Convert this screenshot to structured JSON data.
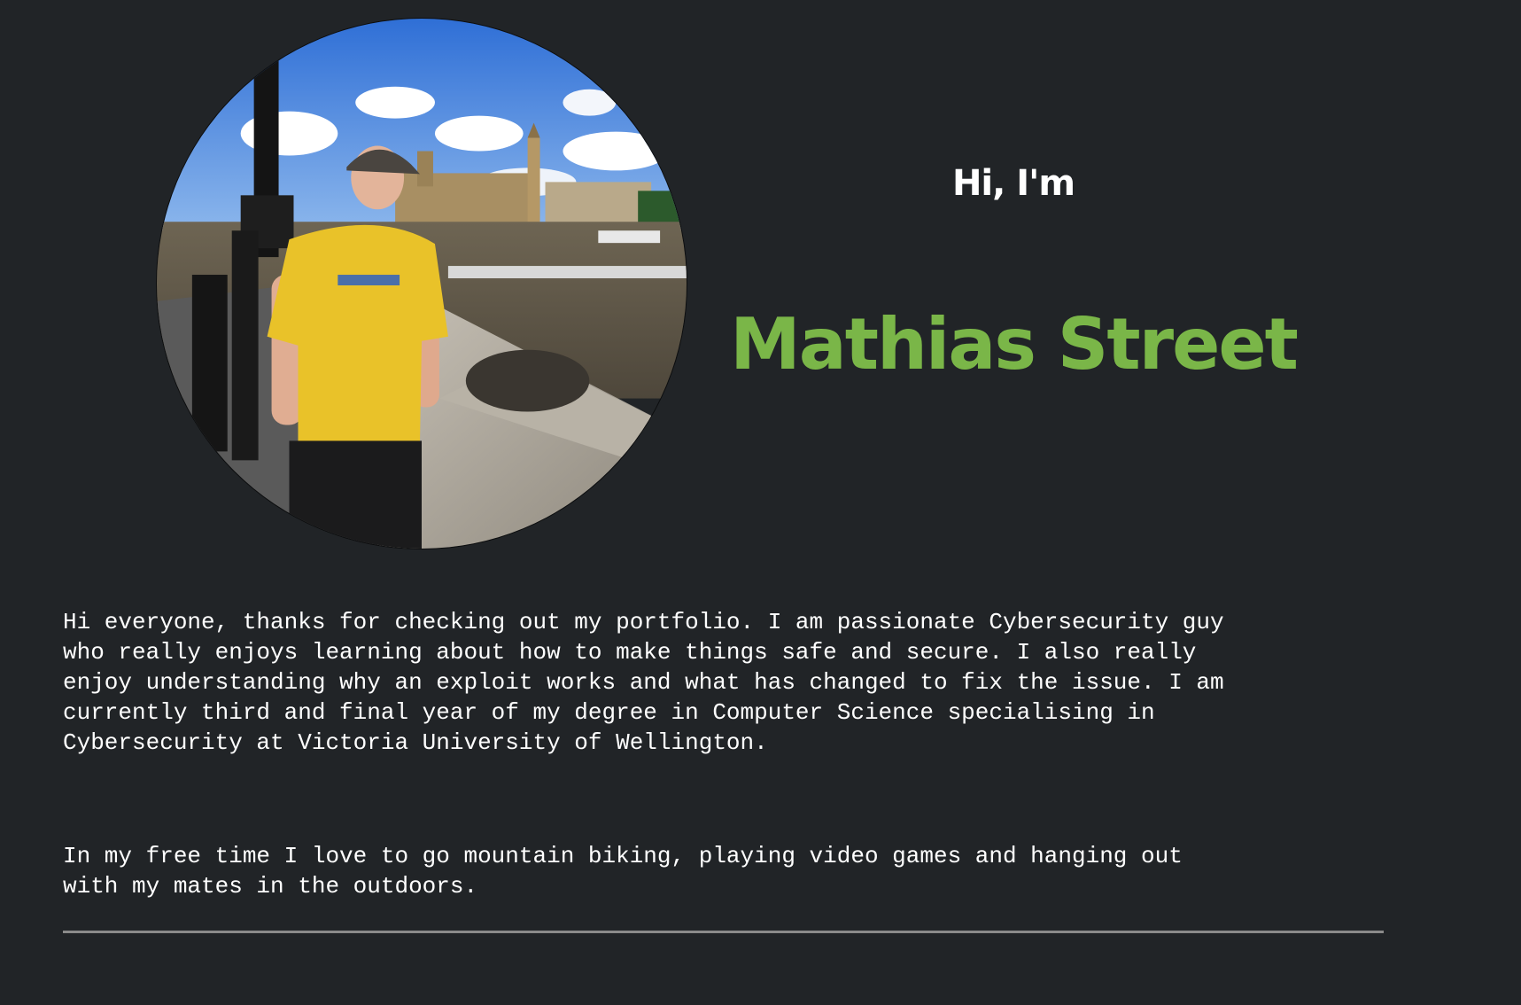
{
  "hero": {
    "greeting": "Hi, I'm",
    "name": "Mathias Street",
    "photo_icon": "profile-photo",
    "accent_color": "#7ab648"
  },
  "about": {
    "paragraph_1_lines": [
      "Hi everyone, thanks for checking out my portfolio. I am passionate Cybersecurity guy",
      "who really enjoys learning about how to make things safe and secure. I also really",
      "enjoy understanding why an exploit works and what has changed to fix the issue. I am",
      "currently third and final year of my degree in Computer Science specialising in",
      "Cybersecurity at Victoria University of Wellington."
    ],
    "paragraph_2_lines": [
      "In my free time I love to go mountain biking, playing video games and hanging out",
      "with my mates in the outdoors."
    ]
  },
  "theme": {
    "background": "#212427",
    "text": "#ffffff",
    "divider": "#8a8a8a"
  }
}
